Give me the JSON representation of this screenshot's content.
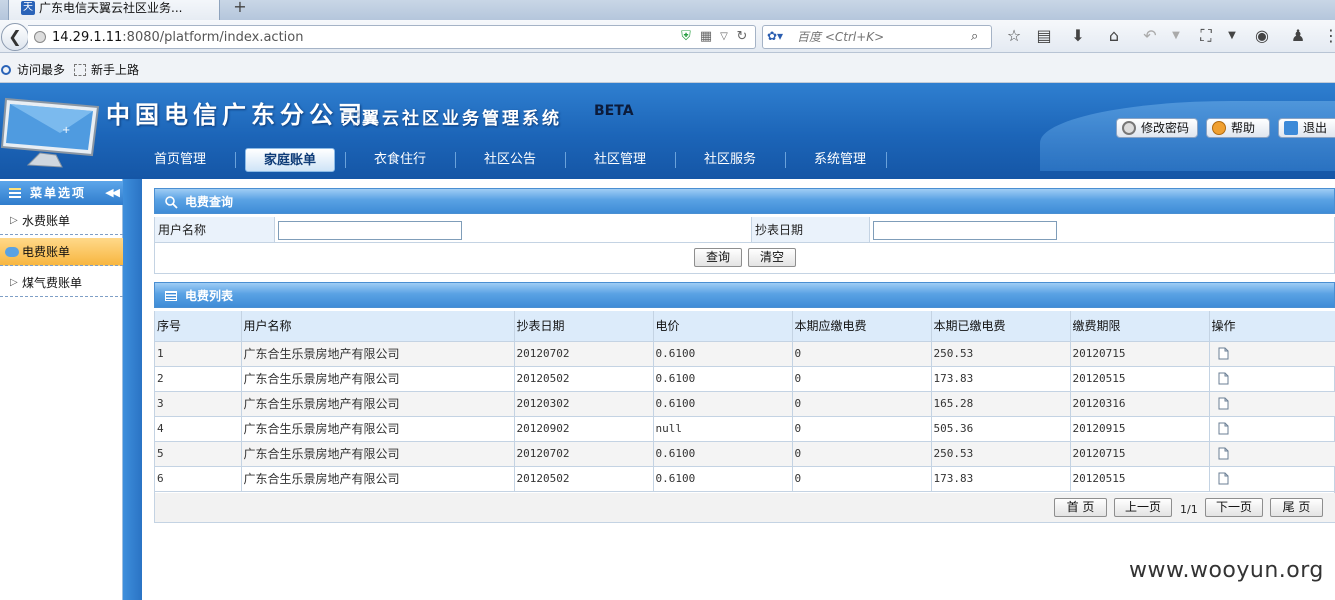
{
  "browser": {
    "tab_title": "广东电信天翼云社区业务...",
    "new_tab": "+",
    "url_host": "14.29.1.11",
    "url_rest": ":8080/platform/index.action",
    "search_placeholder": "百度 <Ctrl+K>",
    "bookmarks": [
      "访问最多",
      "新手上路"
    ]
  },
  "header": {
    "site_title": "中国电信广东分公司",
    "system_title": "天翼云社区业务管理系统",
    "beta": "BETA",
    "buttons": [
      "修改密码",
      "帮助",
      "退出"
    ]
  },
  "nav": {
    "items": [
      "首页管理",
      "家庭账单",
      "衣食住行",
      "社区公告",
      "社区管理",
      "社区服务",
      "系统管理"
    ],
    "active": "家庭账单"
  },
  "sidebar": {
    "title": "菜单选项",
    "items": [
      "水费账单",
      "电费账单",
      "煤气费账单"
    ],
    "active": "电费账单"
  },
  "query": {
    "title": "电费查询",
    "user_label": "用户名称",
    "date_label": "抄表日期",
    "user_value": "",
    "date_value": "",
    "search_btn": "查询",
    "clear_btn": "清空"
  },
  "list": {
    "title": "电费列表",
    "columns": [
      "序号",
      "用户名称",
      "抄表日期",
      "电价",
      "本期应缴电费",
      "本期已缴电费",
      "缴费期限",
      "操作"
    ],
    "rows": [
      [
        "1",
        "广东合生乐景房地产有限公司",
        "20120702",
        "0.6100",
        "0",
        "250.53",
        "20120715"
      ],
      [
        "2",
        "广东合生乐景房地产有限公司",
        "20120502",
        "0.6100",
        "0",
        "173.83",
        "20120515"
      ],
      [
        "3",
        "广东合生乐景房地产有限公司",
        "20120302",
        "0.6100",
        "0",
        "165.28",
        "20120316"
      ],
      [
        "4",
        "广东合生乐景房地产有限公司",
        "20120902",
        "null",
        "0",
        "505.36",
        "20120915"
      ],
      [
        "5",
        "广东合生乐景房地产有限公司",
        "20120702",
        "0.6100",
        "0",
        "250.53",
        "20120715"
      ],
      [
        "6",
        "广东合生乐景房地产有限公司",
        "20120502",
        "0.6100",
        "0",
        "173.83",
        "20120515"
      ]
    ],
    "pager": {
      "first": "首 页",
      "prev": "上一页",
      "count": "1/1",
      "next": "下一页",
      "last": "尾 页"
    }
  },
  "watermark": "www.wooyun.org",
  "colors": {
    "header_blue": "#1c65b8",
    "active_menu": "#f7b640",
    "panel_head": "#5aa2e4"
  }
}
